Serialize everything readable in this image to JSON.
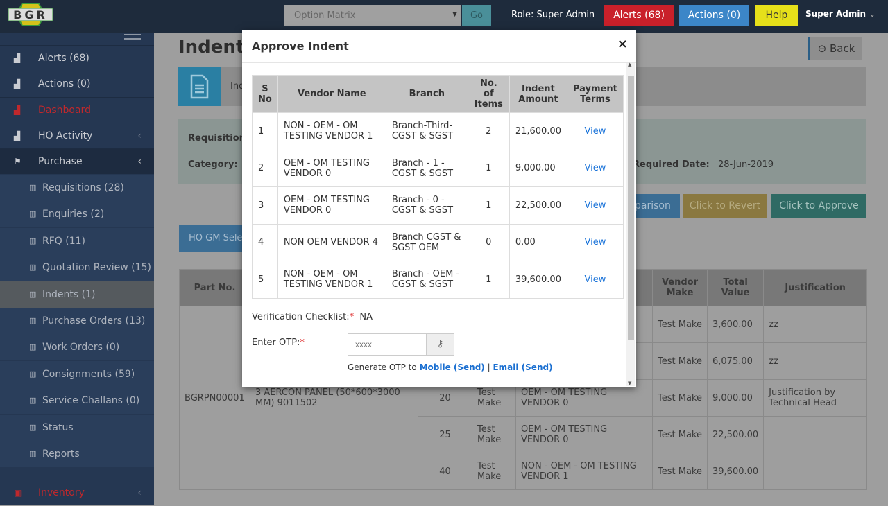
{
  "topbar": {
    "logo": "BGR",
    "select_value": "Option Matrix",
    "go": "Go",
    "role": "Role: Super Admin",
    "alerts": "Alerts (68)",
    "actions": "Actions (0)",
    "help": "Help",
    "user": "Super Admin",
    "colors": {
      "alerts": "#c9202a",
      "actions": "#3c86c8",
      "help": "#e6e01a"
    }
  },
  "sidebar": {
    "items": [
      {
        "label": "Alerts (68)",
        "icon": "chart-icon"
      },
      {
        "label": "Actions (0)",
        "icon": "chart-icon"
      },
      {
        "label": "Dashboard",
        "icon": "chart-icon"
      },
      {
        "label": "HO Activity",
        "icon": "chart-icon"
      },
      {
        "label": "Purchase",
        "icon": "flag-icon"
      }
    ],
    "sub": [
      "Requisitions (28)",
      "Enquiries (2)",
      "RFQ (11)",
      "Quotation Review (15)",
      "Indents (1)",
      "Purchase Orders (13)",
      "Work Orders (0)",
      "Consignments (59)",
      "Service Challans (0)",
      "Status",
      "Reports"
    ],
    "bottom": "Inventory",
    "active_sub": "Indents (1)"
  },
  "page": {
    "title": "Indent",
    "back": "Back",
    "band_text": "Ind",
    "req_label": "Requisition",
    "category_label": "Category:",
    "required_date_label": "Required Date:",
    "required_date": "28-Jun-2019",
    "buttons": {
      "comparison": "parison",
      "revert": "Click to Revert",
      "approve": "Click to Approve"
    },
    "tab": "HO GM Sele",
    "table": {
      "headers": [
        "Part No.",
        "",
        "",
        "",
        "",
        "Vendor Make",
        "Total Value",
        "Justification"
      ],
      "part_no": "BGRPN00001",
      "description": "3 AERCON PANEL (50*600*3000 MM) 9011502",
      "rows": [
        {
          "qty": "",
          "make": "",
          "vendor": "",
          "vmake": "Test Make",
          "total": "3,600.00",
          "just": "zz"
        },
        {
          "qty": "",
          "make": "",
          "vendor": "",
          "vmake": "Test Make",
          "total": "6,075.00",
          "just": "zz"
        },
        {
          "qty": "20",
          "make": "Test Make",
          "vendor": "OEM - OM TESTING VENDOR 0",
          "vmake": "Test Make",
          "total": "9,000.00",
          "just": "Justification by Technical Head"
        },
        {
          "qty": "25",
          "make": "Test Make",
          "vendor": "OEM - OM TESTING VENDOR 0",
          "vmake": "Test Make",
          "total": "22,500.00",
          "just": ""
        },
        {
          "qty": "40",
          "make": "Test Make",
          "vendor": "NON - OEM - OM TESTING VENDOR 1",
          "vmake": "Test Make",
          "total": "39,600.00",
          "just": ""
        }
      ]
    }
  },
  "modal": {
    "title": "Approve Indent",
    "close": "×",
    "headers": [
      "S No",
      "Vendor Name",
      "Branch",
      "No. of Items",
      "Indent Amount",
      "Payment Terms"
    ],
    "rows": [
      {
        "sno": "1",
        "vendor": "NON - OEM - OM TESTING VENDOR 1",
        "branch": "Branch-Third-CGST & SGST",
        "items": "2",
        "amount": "21,600.00",
        "terms": "View"
      },
      {
        "sno": "2",
        "vendor": "OEM - OM TESTING VENDOR 0",
        "branch": "Branch - 1 - CGST & SGST",
        "items": "1",
        "amount": "9,000.00",
        "terms": "View"
      },
      {
        "sno": "3",
        "vendor": "OEM - OM TESTING VENDOR 0",
        "branch": "Branch - 0 - CGST & SGST",
        "items": "1",
        "amount": "22,500.00",
        "terms": "View"
      },
      {
        "sno": "4",
        "vendor": "NON OEM VENDOR 4",
        "branch": "Branch CGST & SGST OEM",
        "items": "0",
        "amount": "0.00",
        "terms": "View"
      },
      {
        "sno": "5",
        "vendor": "NON - OEM - OM TESTING VENDOR 1",
        "branch": "Branch - OEM - CGST & SGST",
        "items": "1",
        "amount": "39,600.00",
        "terms": "View"
      }
    ],
    "checklist_label": "Verification Checklist:",
    "checklist_value": "NA",
    "otp_label": "Enter OTP:",
    "otp_placeholder": "xxxx",
    "otp_value": "",
    "generate_prefix": "Generate OTP to",
    "mobile_link": "Mobile (Send)",
    "separator": "|",
    "email_link": "Email (Send)"
  }
}
